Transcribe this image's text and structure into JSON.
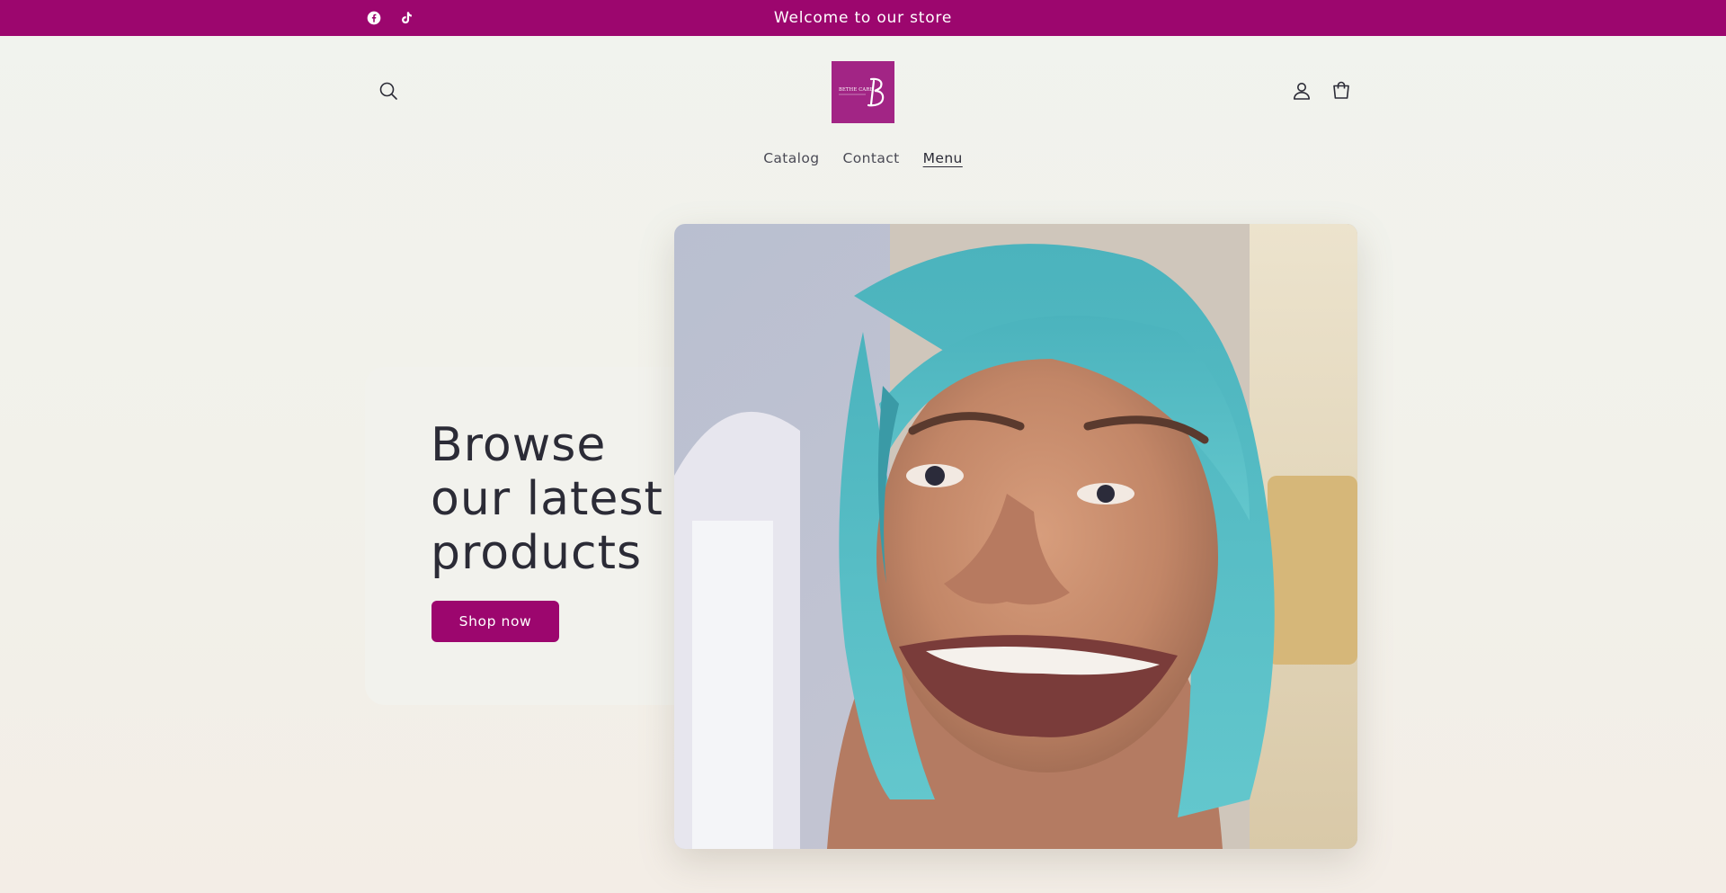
{
  "announcement": {
    "text": "Welcome to our store"
  },
  "social": [
    {
      "icon": "facebook-icon"
    },
    {
      "icon": "tiktok-icon"
    }
  ],
  "header": {
    "search_icon": "search-icon",
    "account_icon": "user-icon",
    "cart_icon": "cart-icon",
    "logo_text": "BETHE CARE"
  },
  "nav": {
    "items": [
      {
        "label": "Catalog"
      },
      {
        "label": "Contact"
      },
      {
        "label": "Menu",
        "active": true
      }
    ]
  },
  "hero": {
    "title": "Browse our latest products",
    "button_label": "Shop now"
  },
  "colors": {
    "brand": "#9c066e",
    "logo_bg": "#a22585",
    "text": "#2b2b36",
    "background": "#f2f2ed"
  }
}
